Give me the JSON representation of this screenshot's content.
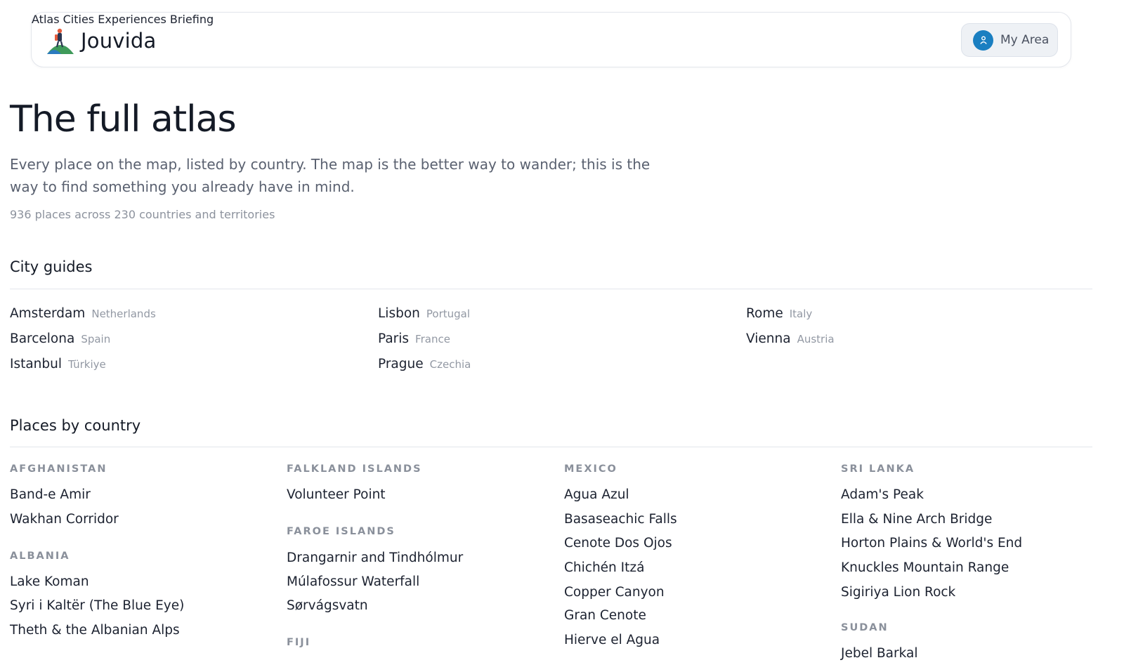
{
  "header": {
    "brand": "Jouvida",
    "nav": [
      "Atlas",
      "Cities",
      "Experiences",
      "Briefing"
    ],
    "my_area": "My Area",
    "colors": {
      "avatar": "#1a7fc1",
      "my_area_bg": "#eef1f5"
    }
  },
  "main": {
    "title": "The full atlas",
    "intro": "Every place on the map, listed by country. The map is the better way to wander; this is the way to find something you already have in mind.",
    "stats": "936 places across 230 countries and territories"
  },
  "city_guides": {
    "title": "City guides",
    "items": [
      {
        "city": "Amsterdam",
        "country": "Netherlands"
      },
      {
        "city": "Barcelona",
        "country": "Spain"
      },
      {
        "city": "Istanbul",
        "country": "Türkiye"
      },
      {
        "city": "Lisbon",
        "country": "Portugal"
      },
      {
        "city": "Paris",
        "country": "France"
      },
      {
        "city": "Prague",
        "country": "Czechia"
      },
      {
        "city": "Rome",
        "country": "Italy"
      },
      {
        "city": "Vienna",
        "country": "Austria"
      }
    ]
  },
  "places": {
    "title": "Places by country",
    "afghanistan": {
      "name": "AFGHANISTAN",
      "places": [
        "Band-e Amir",
        "Wakhan Corridor"
      ]
    },
    "albania": {
      "name": "ALBANIA",
      "places": [
        "Lake Koman",
        "Syri i Kaltër (The Blue Eye)",
        "Theth & the Albanian Alps"
      ]
    },
    "falkland": {
      "name": "FALKLAND ISLANDS",
      "places": [
        "Volunteer Point"
      ]
    },
    "faroe": {
      "name": "FAROE ISLANDS",
      "places": [
        "Drangarnir and Tindhólmur",
        "Múlafossur Waterfall",
        "Sørvágsvatn"
      ]
    },
    "fiji": {
      "name": "FIJI",
      "places": []
    },
    "mexico": {
      "name": "MEXICO",
      "places": [
        "Agua Azul",
        "Basaseachic Falls",
        "Cenote Dos Ojos",
        "Chichén Itzá",
        "Copper Canyon",
        "Gran Cenote",
        "Hierve el Agua"
      ]
    },
    "srilanka": {
      "name": "SRI LANKA",
      "places": [
        "Adam's Peak",
        "Ella & Nine Arch Bridge",
        "Horton Plains & World's End",
        "Knuckles Mountain Range",
        "Sigiriya Lion Rock"
      ]
    },
    "sudan": {
      "name": "SUDAN",
      "places": [
        "Jebel Barkal"
      ]
    }
  }
}
